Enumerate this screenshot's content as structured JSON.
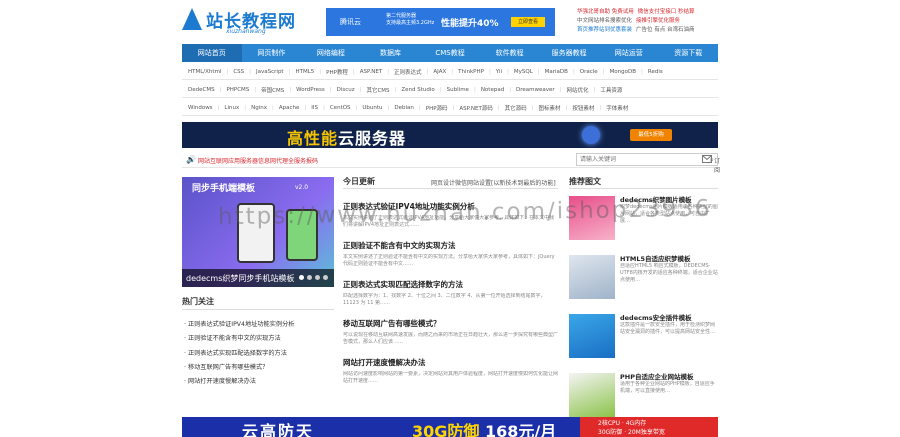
{
  "header": {
    "logo_title": "站长教程网",
    "logo_sub": "xiuzhanwang",
    "ad": {
      "brand": "腾讯云",
      "mid_line1": "第二代服务器",
      "mid_line2": "支持最高主频3.2GHz",
      "big": "性能提升40%",
      "btn": "立即查看"
    },
    "links": [
      [
        "华强北哥自助 免费试用",
        "微信支付宝接口 秒结算"
      ],
      [
        "中文网站排名搜索优化",
        "接推引擎优化服务"
      ],
      [
        "首页推荐站到优惠套装",
        "广告位 有点 台湾石油商"
      ]
    ]
  },
  "nav": [
    "网站首页",
    "网页制作",
    "网络编程",
    "数据库",
    "CMS教程",
    "软件教程",
    "服务器教程",
    "网站运营",
    "资源下载"
  ],
  "category_rows": [
    [
      "HTML/Xhtml",
      "CSS",
      "JavaScript",
      "HTML5",
      "PHP教程",
      "ASP.NET",
      "正则表达式",
      "AJAX",
      "ThinkPHP",
      "Yii",
      "MySQL",
      "MariaDB",
      "Oracle",
      "MongoDB",
      "Redis"
    ],
    [
      "DedeCMS",
      "PHPCMS",
      "帝国CMS",
      "WordPress",
      "Discuz",
      "其它CMS",
      "Zend Studio",
      "Sublime",
      "Notepad",
      "Dreamweaver",
      "网站优化",
      "工具资源"
    ],
    [
      "Windows",
      "Linux",
      "Nginx",
      "Apache",
      "IIS",
      "CentOS",
      "Ubuntu",
      "Debian",
      "PHP源码",
      "ASP.NET源码",
      "其它源码",
      "图标素材",
      "按钮素材",
      "字体素材"
    ]
  ],
  "banner": {
    "title_pre": "高性能",
    "title_post": "云服务器",
    "btn": "最低5折购"
  },
  "notice": {
    "text": "网站互联网应用服务器信息网代理全服务报码",
    "subscribe": "订阅"
  },
  "search": {
    "placeholder": "请输入关键词"
  },
  "slider": {
    "head": "同步手机端模板",
    "version": "v2.0",
    "caption": "dedecms织梦同步手机站模板"
  },
  "hot": {
    "title": "热门关注",
    "items": [
      "正则表达式验证IPV4地址功能实例分析",
      "正则验证不能含有中文的实现方法",
      "正则表达式实现匹配选择数字的方法",
      "移动互联网广告有哪些模式？",
      "网站打开速度慢解决办法"
    ]
  },
  "latest": {
    "tab": "今日更新",
    "tab2": "网页设计微信网站设置[以新技术到最后的功能]",
    "articles": [
      {
        "title": "正则表达式验证IPV4地址功能实例分析",
        "desc": "本文实例讲述了正则表达式验证IPV4地址功能。分享给大家供大家参考，具体如下：在本文中我们将讲解IPV4地址正则表达式……"
      },
      {
        "title": "正则验证不能含有中文的实现方法",
        "desc": "本文实例讲述了正则验证不能含有中文的实现方法。分享给大家供大家参考，具体如下：jQuery代码正则验证不能含有中文……"
      },
      {
        "title": "正则表达式实现匹配选择数字的方法",
        "desc": "匹配选择数字为：1、找数字 2、十位之间 3、二位数字 4、从第一位开始选择到结尾数字，11123 为 11 第……"
      },
      {
        "title": "移动互联网广告有哪些模式？",
        "desc": "可以说现在移动互联网高速发展，而随之而来的市场正在日趋壮大，那么进一步探究有哪些典型广告模式，那么人们应该……"
      },
      {
        "title": "网站打开速度慢解决办法",
        "desc": "网站访问速度影响网站的第一要素，决定网站对其用户体验程度，网站打开速度慢如何优化能让网站打开速度……"
      }
    ]
  },
  "recommended": {
    "title": "推荐图文",
    "items": [
      {
        "title": "dedecms织梦图片模板",
        "desc": "织梦dedecms图片模板适用于各种类型的图片网站，适合各类型站点使用，可自由扩展…"
      },
      {
        "title": "HTML5自适应织梦模板",
        "desc": "自适应HTML5 响应式模板，DEDECMS-UTF8内核开发的适应各种终端，适合企业站点使用…"
      },
      {
        "title": "dedecms安全插件模板",
        "desc": "这款插件是一款安全插件，用于检测织梦网站安全漏洞的插件，可以提高网站安全性…"
      },
      {
        "title": "PHP自适应企业网站模板",
        "desc": "适用于各种企业网站的PHP模板，自适应手机端，可以直接使用…"
      }
    ]
  },
  "bottom_banner": {
    "t1": "云高防天",
    "t2": "30G防御",
    "t3": "168元/月",
    "r1": "2核CPU · 4G内存",
    "r2": "30G防御 · 20M独享带宽"
  },
  "watermark": "https://www.huzhan.com/ishop23936",
  "colors": {
    "nav_blue": "#2a86d3",
    "brand_blue": "#1c7bd1",
    "notice_red": "#d8272d"
  }
}
